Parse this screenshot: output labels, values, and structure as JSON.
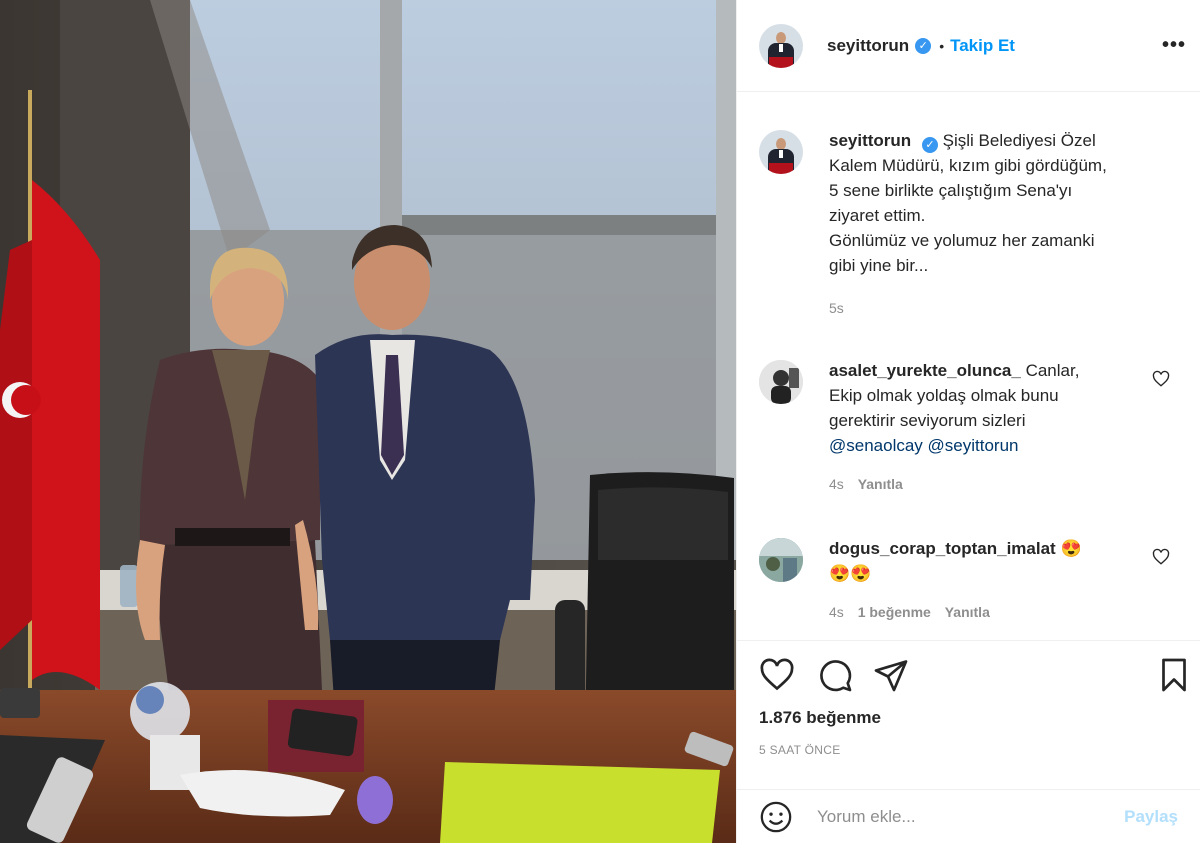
{
  "post": {
    "username": "seyittorun",
    "follow_label": "Takip Et",
    "separator": "•",
    "more_label": "•••"
  },
  "caption": {
    "username": "seyittorun",
    "text_line1": "Şişli Belediyesi Özel",
    "text_line2": "Kalem Müdürü, kızım gibi gördüğüm,",
    "text_line3": "5 sene birlikte çalıştığım Sena'yı",
    "text_line4": "ziyaret ettim.",
    "text_line5": "Gönlümüz ve yolumuz her zamanki",
    "text_line6": "gibi yine bir...",
    "time": "5s"
  },
  "comments": [
    {
      "username": "asalet_yurekte_olunca_",
      "text_line1": "Canlar,",
      "text_line2": "Ekip olmak yoldaş olmak bunu",
      "text_line3": "gerektirir seviyorum sizleri",
      "mention1": "@senaolcay",
      "mention2": "@seyittorun",
      "time": "4s",
      "reply_label": "Yanıtla"
    },
    {
      "username": "dogus_corap_toptan_imalat",
      "emoji_line1": "😍",
      "emoji_line2": "😍😍",
      "time": "4s",
      "likes_label": "1 beğenme",
      "reply_label": "Yanıtla"
    }
  ],
  "actions": {
    "likes_count": "1.876 beğenme",
    "time_ago": "5 SAAT ÖNCE",
    "comment_placeholder": "Yorum ekle...",
    "post_label": "Paylaş"
  },
  "icons": {
    "like": "heart-icon",
    "comment": "comment-bubble-icon",
    "share": "paper-plane-icon",
    "save": "bookmark-icon",
    "emoji": "smiley-icon",
    "verified": "verified-badge-icon"
  },
  "colors": {
    "accent": "#0095f6",
    "verified": "#3897f0",
    "text": "#262626",
    "muted": "#8e8e8e",
    "mention": "#00376b",
    "post_disabled": "#b2dffc"
  }
}
